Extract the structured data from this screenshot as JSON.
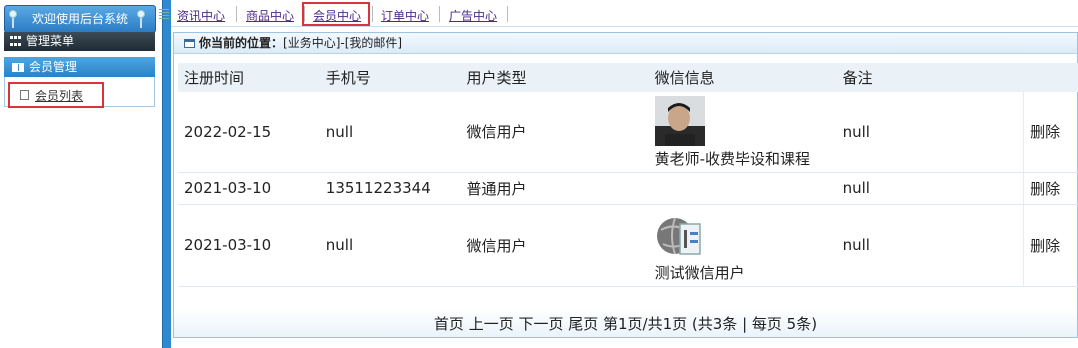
{
  "sidebar": {
    "brand": "欢迎使用后台系统",
    "menu_title": "管理菜单",
    "group_label": "会员管理",
    "link_label": "会员列表"
  },
  "topnav": {
    "tabs": [
      "资讯中心",
      "商品中心",
      "会员中心",
      "订单中心",
      "广告中心"
    ],
    "active_index": 2
  },
  "location": {
    "label": "你当前的位置：",
    "path": "[业务中心]-[我的邮件]"
  },
  "table": {
    "headers": [
      "注册时间",
      "手机号",
      "用户类型",
      "微信信息",
      "备注",
      ""
    ],
    "rows": [
      {
        "date": "2022-02-15",
        "phone": "null",
        "type": "微信用户",
        "wx_name": "黄老师-收费毕设和课程",
        "avatar": "person-photo",
        "remark": "null",
        "action": "删除"
      },
      {
        "date": "2021-03-10",
        "phone": "13511223344",
        "type": "普通用户",
        "wx_name": "",
        "avatar": "",
        "remark": "null",
        "action": "删除"
      },
      {
        "date": "2021-03-10",
        "phone": "null",
        "type": "微信用户",
        "wx_name": "测试微信用户",
        "avatar": "globe-document-icon",
        "remark": "null",
        "action": "删除"
      }
    ]
  },
  "pager": {
    "text": "首页 上一页 下一页 尾页 第1页/共1页 (共3条 | 每页 5条)"
  },
  "colors": {
    "accent": "#2e89cf",
    "highlight_border": "#d9333b"
  }
}
